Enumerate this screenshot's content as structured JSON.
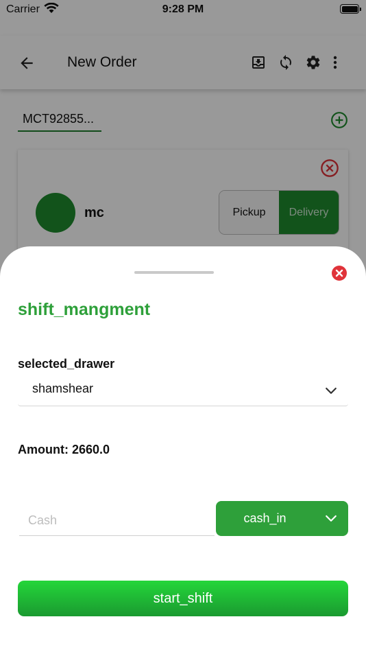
{
  "status_bar": {
    "carrier": "Carrier",
    "time": "9:28 PM",
    "wifi_icon": "wifi-icon",
    "battery_icon": "battery-icon"
  },
  "app_bar": {
    "title": "New Order",
    "back_icon": "arrow-back-icon",
    "action_icons": [
      "download-icon",
      "sync-icon",
      "settings-icon",
      "more-vert-icon"
    ]
  },
  "order": {
    "reference": "MCT92855...",
    "add_icon": "add-circle-icon"
  },
  "customer_card": {
    "name": "mc",
    "close_icon": "cancel-circle-icon",
    "order_types": [
      "Pickup",
      "Delivery"
    ],
    "selected_order_type": "Delivery"
  },
  "sheet": {
    "title": "shift_mangment",
    "close_icon": "close-circle-icon",
    "drawer_label": "selected_drawer",
    "drawer_value": "shamshear",
    "amount_text": "Amount: 2660.0",
    "cash_placeholder": "Cash",
    "cash_type": "cash_in",
    "start_button": "start_shift"
  },
  "colors": {
    "accent_green": "#2ea03a",
    "dark_green": "#1e8a2e",
    "close_red": "#e0333a",
    "button_gradient_top": "#24d63a",
    "button_gradient_bottom": "#1a9a30"
  }
}
